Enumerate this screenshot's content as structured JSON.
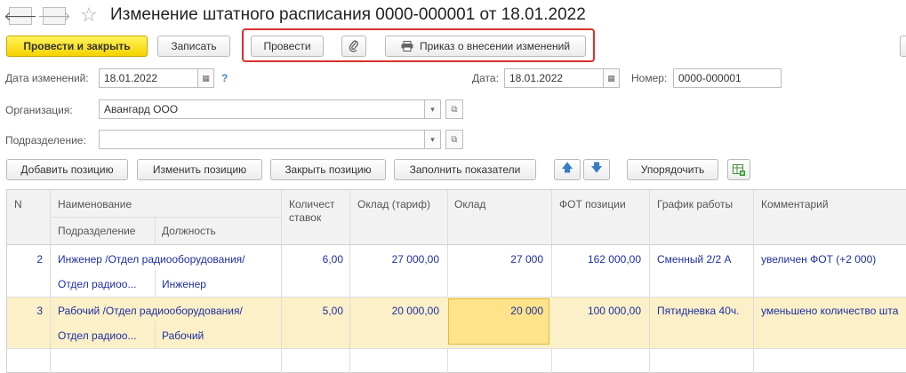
{
  "window": {
    "title": "Изменение штатного расписания 0000-000001 от 18.01.2022"
  },
  "toolbar": {
    "post_close": "Провести и закрыть",
    "save": "Записать",
    "post": "Провести",
    "order": "Приказ о внесении изменений"
  },
  "form": {
    "change_date_label": "Дата изменений:",
    "change_date": "18.01.2022",
    "help": "?",
    "date_label": "Дата:",
    "date": "18.01.2022",
    "number_label": "Номер:",
    "number": "0000-000001",
    "org_label": "Организация:",
    "org": "Авангард ООО",
    "dept_label": "Подразделение:",
    "dept": ""
  },
  "actions": {
    "add": "Добавить позицию",
    "edit": "Изменить позицию",
    "close": "Закрыть позицию",
    "fill": "Заполнить показатели",
    "sort": "Упорядочить"
  },
  "table": {
    "headers": {
      "n": "N",
      "name": "Наименование",
      "subdept": "Подразделение",
      "position": "Должность",
      "rates": "Количест ставок",
      "salary_tariff": "Оклад (тариф)",
      "salary": "Оклад",
      "fot": "ФОТ позиции",
      "schedule": "График работы",
      "comment": "Комментарий"
    },
    "rows": [
      {
        "n": "2",
        "name": "Инженер /Отдел радиооборудования/",
        "subdept": "Отдел радиоо...",
        "position": "Инженер",
        "rates": "6,00",
        "salary_tariff": "27 000,00",
        "salary": "27 000",
        "fot": "162 000,00",
        "schedule": "Сменный 2/2 А",
        "comment": "увеличен ФОТ (+2 000)"
      },
      {
        "n": "3",
        "name": "Рабочий /Отдел радиооборудования/",
        "subdept": "Отдел радиоо...",
        "position": "Рабочий",
        "rates": "5,00",
        "salary_tariff": "20 000,00",
        "salary": "20 000",
        "fot": "100 000,00",
        "schedule": "Пятидневка 40ч.",
        "comment": "уменьшено количество шта"
      }
    ]
  }
}
